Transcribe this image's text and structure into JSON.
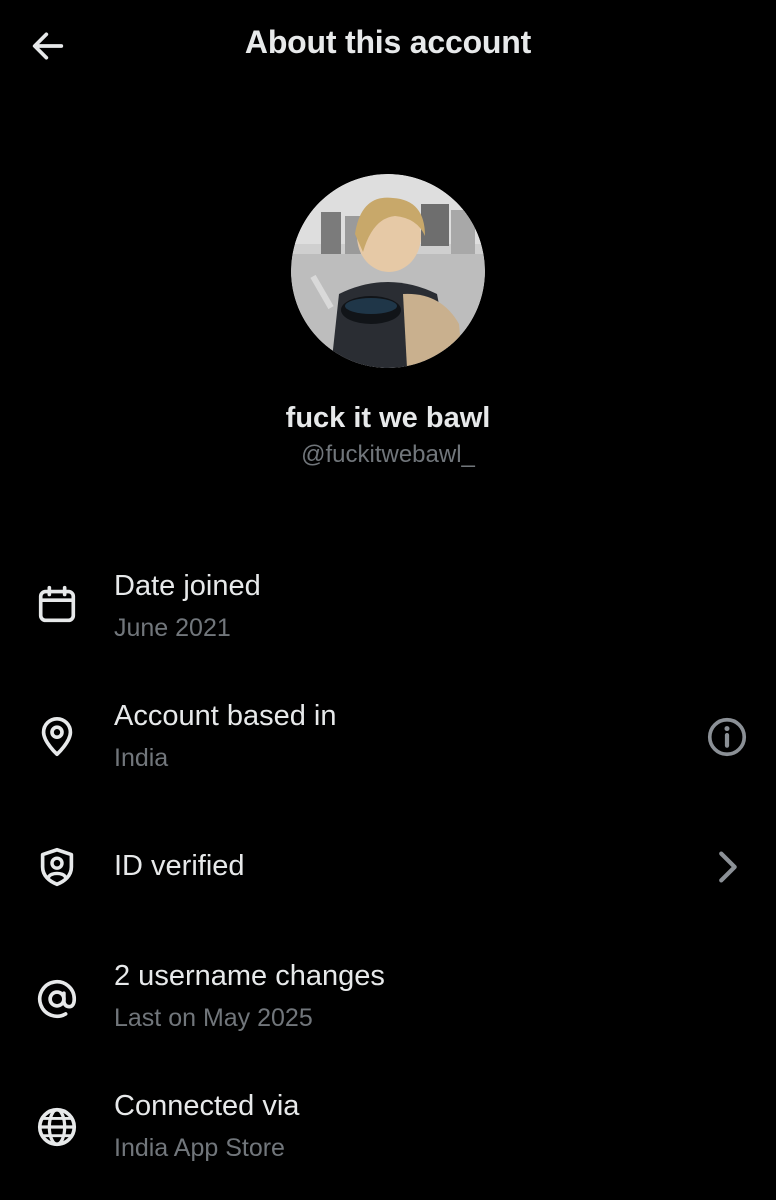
{
  "header": {
    "title": "About this account",
    "back_icon": "arrow-left-icon"
  },
  "profile": {
    "display_name": "fuck it we bawl",
    "handle": "@fuckitwebawl_"
  },
  "rows": [
    {
      "icon": "calendar-icon",
      "title": "Date joined",
      "subtitle": "June 2021"
    },
    {
      "icon": "location-pin-icon",
      "title": "Account based in",
      "subtitle": "India",
      "trailing_icon": "info-icon"
    },
    {
      "icon": "shield-person-icon",
      "title": "ID verified",
      "trailing_icon": "chevron-right-icon"
    },
    {
      "icon": "at-sign-icon",
      "title": "2 username changes",
      "subtitle": "Last on May 2025"
    },
    {
      "icon": "globe-icon",
      "title": "Connected via",
      "subtitle": "India App Store"
    }
  ],
  "colors": {
    "background": "#000000",
    "primary_text": "#e7e9ea",
    "secondary_text": "#71767b"
  }
}
